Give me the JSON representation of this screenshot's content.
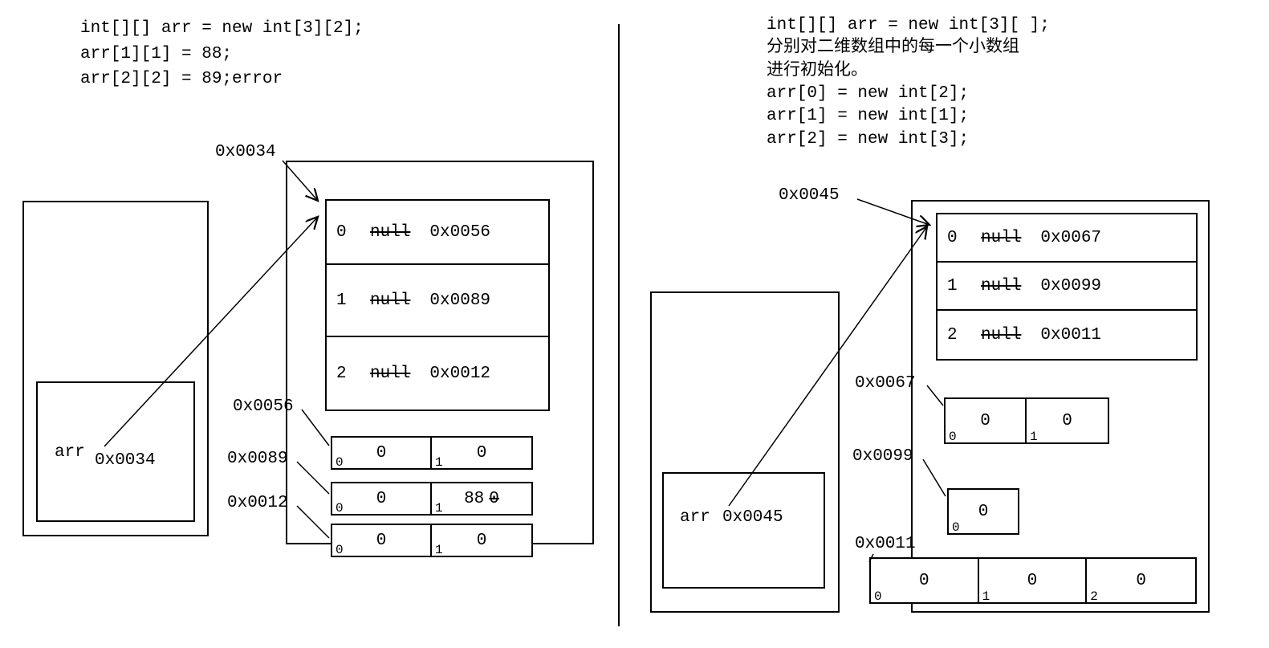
{
  "left": {
    "code": "int[][] arr = new int[3][2];\narr[1][1] = 88;\narr[2][2] = 89;error",
    "addr_main": "0x0034",
    "stack_var": "arr",
    "stack_val": "0x0034",
    "outer": [
      {
        "idx": "0",
        "old": "null",
        "addr": "0x0056"
      },
      {
        "idx": "1",
        "old": "null",
        "addr": "0x0089"
      },
      {
        "idx": "2",
        "old": "null",
        "addr": "0x0012"
      }
    ],
    "inner_labels": [
      "0x0056",
      "0x0089",
      "0x0012"
    ],
    "inner_rows": [
      [
        {
          "i": "0",
          "v": "0"
        },
        {
          "i": "1",
          "v": "0"
        }
      ],
      [
        {
          "i": "0",
          "v": "0"
        },
        {
          "i": "1",
          "v": "88",
          "s": "0"
        }
      ],
      [
        {
          "i": "0",
          "v": "0"
        },
        {
          "i": "1",
          "v": "0"
        }
      ]
    ]
  },
  "right": {
    "code": "int[][] arr = new int[3][ ];\n分别对二维数组中的每一个小数组\n进行初始化。\narr[0] = new int[2];\narr[1] = new int[1];\narr[2] = new int[3];",
    "addr_main": "0x0045",
    "stack_var": "arr",
    "stack_val": "0x0045",
    "outer": [
      {
        "idx": "0",
        "old": "null",
        "addr": "0x0067"
      },
      {
        "idx": "1",
        "old": "null",
        "addr": "0x0099"
      },
      {
        "idx": "2",
        "old": "null",
        "addr": "0x0011"
      }
    ],
    "inner_labels": [
      "0x0067",
      "0x0099",
      "0x0011"
    ],
    "inner_rows": [
      [
        {
          "i": "0",
          "v": "0"
        },
        {
          "i": "1",
          "v": "0"
        }
      ],
      [
        {
          "i": "0",
          "v": "0"
        }
      ],
      [
        {
          "i": "0",
          "v": "0"
        },
        {
          "i": "1",
          "v": "0"
        },
        {
          "i": "2",
          "v": "0"
        }
      ]
    ]
  }
}
